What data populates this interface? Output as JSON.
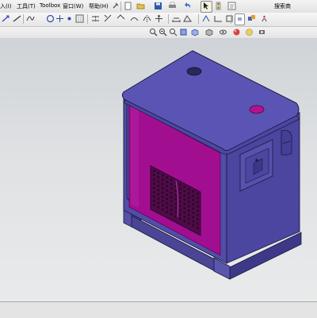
{
  "menus": [
    "入(I)",
    "工具(T)",
    "Toolbox",
    "窗口(W)",
    "帮助(H)"
  ],
  "search_hint": "搜索商",
  "colors": {
    "cabinet_top": "#5a55b5",
    "cabinet_side": "#4b469f",
    "cabinet_front": "#564fb0",
    "panel_magenta": "#a10f90",
    "edge": "#1b1a3c",
    "background_top": "#cfd3d7",
    "background_bottom": "#e9eaeb"
  },
  "toolbar_icons": [
    "sketch-icon",
    "line-icon",
    "circle-icon",
    "arc-icon",
    "point-icon",
    "centerpoint-icon",
    "grid-icon",
    "relations-icon",
    "new-doc-icon",
    "open-icon",
    "save-icon",
    "print-icon",
    "undo-icon",
    "select-icon",
    "rebuild-icon",
    "options-icon"
  ],
  "view_icons": [
    "zoom-fit-icon",
    "zoom-area-icon",
    "previous-view-icon",
    "section-view-icon",
    "view-orientation-icon",
    "display-style-icon",
    "hide-show-icon",
    "appearance-icon",
    "scene-icon",
    "view-settings-icon"
  ]
}
